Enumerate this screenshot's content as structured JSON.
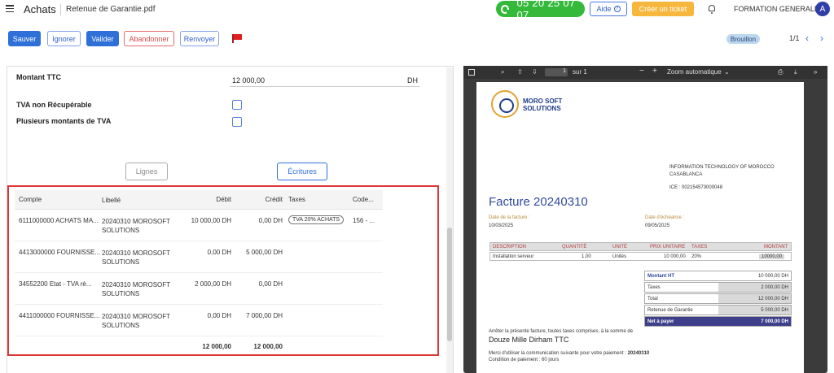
{
  "header": {
    "app_title": "Achats",
    "doc_title": "Retenue de Garantie.pdf",
    "phone": "05 20 25 07 07",
    "help_label": "Aide",
    "ticket_label": "Créer un ticket",
    "org_name": "FORMATION GENERALE",
    "avatar_letter": "A"
  },
  "toolbar": {
    "save_label": "Sauver",
    "ignore_label": "Ignorer",
    "validate_label": "Valider",
    "abandon_label": "Abandonner",
    "resend_label": "Renvoyer"
  },
  "status": {
    "badge": "Brouillon",
    "pager": "1/1"
  },
  "form": {
    "montant_ttc_label": "Montant TTC",
    "montant_ttc_value": "12 000,00",
    "montant_ttc_unit": "DH",
    "tva_non_recup_label": "TVA non Récupérable",
    "plusieurs_tva_label": "Plusieurs montants de TVA"
  },
  "tabs": {
    "lignes": "Lignes",
    "ecritures": "Écritures"
  },
  "grid": {
    "headers": {
      "compte": "Compte",
      "libelle": "Libellé",
      "debit": "Débit",
      "credit": "Crédit",
      "taxes": "Taxes",
      "code": "Code..."
    },
    "rows": [
      {
        "compte": "6111000000 ACHATS MA...",
        "libelle": "20240310 MOROSOFT SOLUTIONS",
        "debit": "10 000,00 DH",
        "credit": "0,00 DH",
        "taxes": "TVA 20% ACHATS",
        "code": "156 - ..."
      },
      {
        "compte": "4413000000 FOURNISSE...",
        "libelle": "20240310 MOROSOFT SOLUTIONS",
        "debit": "0,00 DH",
        "credit": "5 000,00 DH",
        "taxes": "",
        "code": ""
      },
      {
        "compte": "34552200 Etat - TVA rè...",
        "libelle": "20240310 MOROSOFT SOLUTIONS",
        "debit": "2 000,00 DH",
        "credit": "0,00 DH",
        "taxes": "",
        "code": ""
      },
      {
        "compte": "4411000000 FOURNISSE...",
        "libelle": "20240310 MOROSOFT SOLUTIONS",
        "debit": "0,00 DH",
        "credit": "7 000,00 DH",
        "taxes": "",
        "code": ""
      }
    ],
    "total_debit": "12 000,00",
    "total_credit": "12 000,00"
  },
  "pdf": {
    "page_number": "1",
    "page_of": "sur 1",
    "zoom": "Zoom automatique",
    "logo_line1": "MORO SOFT",
    "logo_line2": "SOLUTIONS",
    "recipient_line1": "INFORMATION TECHNOLOGY OF MOROCCO",
    "recipient_line2": "CASABLANCA",
    "ice": "ICE : 002154573000048",
    "invoice_title": "Facture 20240310",
    "date_invoice_label": "Date de la facture :",
    "date_invoice": "10/03/2025",
    "date_due_label": "Date d'échéance :",
    "date_due": "09/05/2025",
    "table_headers": {
      "description": "DESCRIPTION",
      "quantite": "QUANTITÉ",
      "unite": "UNITÉ",
      "prix": "PRIX UNITAIRE",
      "taxes": "TAXES",
      "montant": "MONTANT"
    },
    "table_row": {
      "description": "Installation serveur",
      "quantite": "1,00",
      "unite": "Unités",
      "prix": "10 000,00",
      "taxes": "20%",
      "montant": "10000,00"
    },
    "totals": {
      "montant_ht_label": "Montant HT",
      "montant_ht": "10 000,00 DH",
      "taxes_label": "Taxes",
      "taxes": "2 000,00 DH",
      "total_label": "Total",
      "total": "12 000,00 DH",
      "retenue_label": "Retenue de Garantie",
      "retenue": "5 000,00 DH",
      "net_label": "Net à payer",
      "net": "7 000,00 DH"
    },
    "arret_text": "Arrêter la présente facture, toutes taxes comprises, à la somme de",
    "amount_words": "Douze Mille Dirham TTC",
    "merci_text": "Merci d'utiliser la communication suivante pour votre paiement :",
    "merci_ref": "20240310",
    "payment_terms": "Condition de paiement : 60 jours"
  },
  "colors": {
    "primary": "#2f6fd8",
    "phone_green": "#34b93a",
    "ticket_orange": "#f6b73c",
    "highlight_red": "#e03535",
    "invoice_blue": "#2f4aa0"
  }
}
